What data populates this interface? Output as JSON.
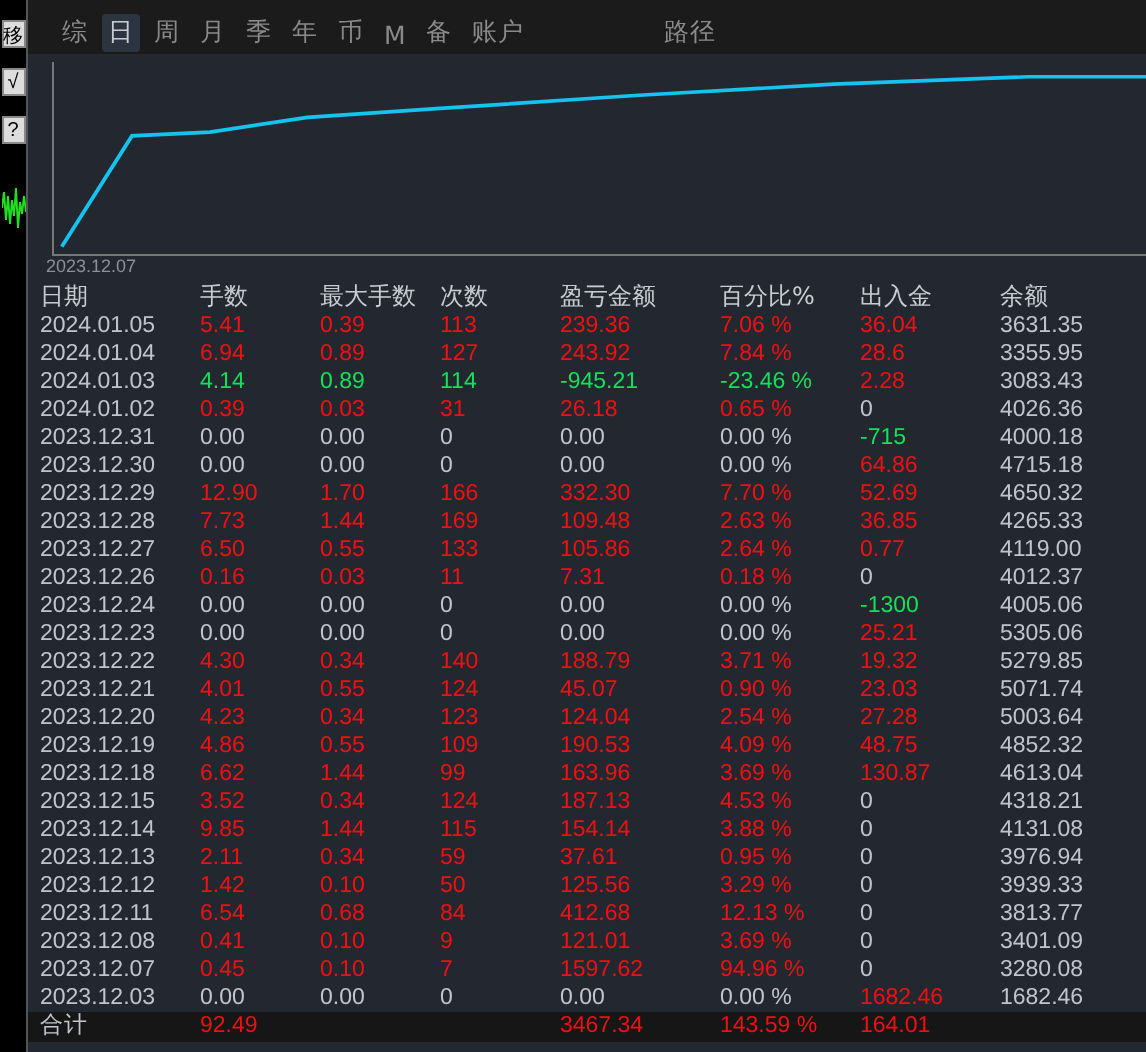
{
  "side_buttons": [
    "移",
    "√",
    "?"
  ],
  "tabs": [
    {
      "label": "综",
      "selected": false
    },
    {
      "label": "日",
      "selected": true
    },
    {
      "label": "周",
      "selected": false
    },
    {
      "label": "月",
      "selected": false
    },
    {
      "label": "季",
      "selected": false
    },
    {
      "label": "年",
      "selected": false
    },
    {
      "label": "币",
      "selected": false
    },
    {
      "label": "M",
      "selected": false
    },
    {
      "label": "备",
      "selected": false
    },
    {
      "label": "账户",
      "selected": false
    },
    {
      "label": "路径",
      "selected": false
    }
  ],
  "chart": {
    "start_label": "2023.12.07"
  },
  "table": {
    "columns": [
      "日期",
      "手数",
      "最大手数",
      "次数",
      "盈亏金额",
      "百分比%",
      "出入金",
      "余额"
    ],
    "rows": [
      {
        "kind": "gain",
        "cells": [
          "2024.01.05",
          "5.41",
          "0.39",
          "113",
          "239.36",
          "7.06 %"
        ],
        "transfer": {
          "kind": "in",
          "amount": "36.04"
        },
        "balance": "3631.35"
      },
      {
        "kind": "gain",
        "cells": [
          "2024.01.04",
          "6.94",
          "0.89",
          "127",
          "243.92",
          "7.84 %"
        ],
        "transfer": {
          "kind": "in",
          "amount": "28.6"
        },
        "balance": "3355.95"
      },
      {
        "kind": "loss",
        "cells": [
          "2024.01.03",
          "4.14",
          "0.89",
          "114",
          "-945.21",
          "-23.46 %"
        ],
        "transfer": {
          "kind": "in",
          "amount": "2.28"
        },
        "balance": "3083.43"
      },
      {
        "kind": "gain",
        "cells": [
          "2024.01.02",
          "0.39",
          "0.03",
          "31",
          "26.18",
          "0.65 %"
        ],
        "transfer": {
          "kind": "none",
          "amount": "0"
        },
        "balance": "4026.36"
      },
      {
        "kind": "flat",
        "cells": [
          "2023.12.31",
          "0.00",
          "0.00",
          "0",
          "0.00",
          "0.00 %"
        ],
        "transfer": {
          "kind": "out",
          "amount": "-715"
        },
        "balance": "4000.18"
      },
      {
        "kind": "flat",
        "cells": [
          "2023.12.30",
          "0.00",
          "0.00",
          "0",
          "0.00",
          "0.00 %"
        ],
        "transfer": {
          "kind": "in",
          "amount": "64.86"
        },
        "balance": "4715.18"
      },
      {
        "kind": "gain",
        "cells": [
          "2023.12.29",
          "12.90",
          "1.70",
          "166",
          "332.30",
          "7.70 %"
        ],
        "transfer": {
          "kind": "in",
          "amount": "52.69"
        },
        "balance": "4650.32"
      },
      {
        "kind": "gain",
        "cells": [
          "2023.12.28",
          "7.73",
          "1.44",
          "169",
          "109.48",
          "2.63 %"
        ],
        "transfer": {
          "kind": "in",
          "amount": "36.85"
        },
        "balance": "4265.33"
      },
      {
        "kind": "gain",
        "cells": [
          "2023.12.27",
          "6.50",
          "0.55",
          "133",
          "105.86",
          "2.64 %"
        ],
        "transfer": {
          "kind": "in",
          "amount": "0.77"
        },
        "balance": "4119.00"
      },
      {
        "kind": "gain",
        "cells": [
          "2023.12.26",
          "0.16",
          "0.03",
          "11",
          "7.31",
          "0.18 %"
        ],
        "transfer": {
          "kind": "none",
          "amount": "0"
        },
        "balance": "4012.37"
      },
      {
        "kind": "flat",
        "cells": [
          "2023.12.24",
          "0.00",
          "0.00",
          "0",
          "0.00",
          "0.00 %"
        ],
        "transfer": {
          "kind": "out",
          "amount": "-1300"
        },
        "balance": "4005.06"
      },
      {
        "kind": "flat",
        "cells": [
          "2023.12.23",
          "0.00",
          "0.00",
          "0",
          "0.00",
          "0.00 %"
        ],
        "transfer": {
          "kind": "in",
          "amount": "25.21"
        },
        "balance": "5305.06"
      },
      {
        "kind": "gain",
        "cells": [
          "2023.12.22",
          "4.30",
          "0.34",
          "140",
          "188.79",
          "3.71 %"
        ],
        "transfer": {
          "kind": "in",
          "amount": "19.32"
        },
        "balance": "5279.85"
      },
      {
        "kind": "gain",
        "cells": [
          "2023.12.21",
          "4.01",
          "0.55",
          "124",
          "45.07",
          "0.90 %"
        ],
        "transfer": {
          "kind": "in",
          "amount": "23.03"
        },
        "balance": "5071.74"
      },
      {
        "kind": "gain",
        "cells": [
          "2023.12.20",
          "4.23",
          "0.34",
          "123",
          "124.04",
          "2.54 %"
        ],
        "transfer": {
          "kind": "in",
          "amount": "27.28"
        },
        "balance": "5003.64"
      },
      {
        "kind": "gain",
        "cells": [
          "2023.12.19",
          "4.86",
          "0.55",
          "109",
          "190.53",
          "4.09 %"
        ],
        "transfer": {
          "kind": "in",
          "amount": "48.75"
        },
        "balance": "4852.32"
      },
      {
        "kind": "gain",
        "cells": [
          "2023.12.18",
          "6.62",
          "1.44",
          "99",
          "163.96",
          "3.69 %"
        ],
        "transfer": {
          "kind": "in",
          "amount": "130.87"
        },
        "balance": "4613.04"
      },
      {
        "kind": "gain",
        "cells": [
          "2023.12.15",
          "3.52",
          "0.34",
          "124",
          "187.13",
          "4.53 %"
        ],
        "transfer": {
          "kind": "none",
          "amount": "0"
        },
        "balance": "4318.21"
      },
      {
        "kind": "gain",
        "cells": [
          "2023.12.14",
          "9.85",
          "1.44",
          "115",
          "154.14",
          "3.88 %"
        ],
        "transfer": {
          "kind": "none",
          "amount": "0"
        },
        "balance": "4131.08"
      },
      {
        "kind": "gain",
        "cells": [
          "2023.12.13",
          "2.11",
          "0.34",
          "59",
          "37.61",
          "0.95 %"
        ],
        "transfer": {
          "kind": "none",
          "amount": "0"
        },
        "balance": "3976.94"
      },
      {
        "kind": "gain",
        "cells": [
          "2023.12.12",
          "1.42",
          "0.10",
          "50",
          "125.56",
          "3.29 %"
        ],
        "transfer": {
          "kind": "none",
          "amount": "0"
        },
        "balance": "3939.33"
      },
      {
        "kind": "gain",
        "cells": [
          "2023.12.11",
          "6.54",
          "0.68",
          "84",
          "412.68",
          "12.13 %"
        ],
        "transfer": {
          "kind": "none",
          "amount": "0"
        },
        "balance": "3813.77"
      },
      {
        "kind": "gain",
        "cells": [
          "2023.12.08",
          "0.41",
          "0.10",
          "9",
          "121.01",
          "3.69 %"
        ],
        "transfer": {
          "kind": "none",
          "amount": "0"
        },
        "balance": "3401.09"
      },
      {
        "kind": "gain",
        "cells": [
          "2023.12.07",
          "0.45",
          "0.10",
          "7",
          "1597.62",
          "94.96 %"
        ],
        "transfer": {
          "kind": "none",
          "amount": "0"
        },
        "balance": "3280.08"
      },
      {
        "kind": "flat",
        "cells": [
          "2023.12.03",
          "0.00",
          "0.00",
          "0",
          "0.00",
          "0.00 %"
        ],
        "transfer": {
          "kind": "in",
          "amount": "1682.46"
        },
        "balance": "1682.46"
      }
    ],
    "total": {
      "label": "合计",
      "lots": "92.49",
      "profit": "3467.34",
      "percent": "143.59 %",
      "transfer": "164.01"
    }
  }
}
